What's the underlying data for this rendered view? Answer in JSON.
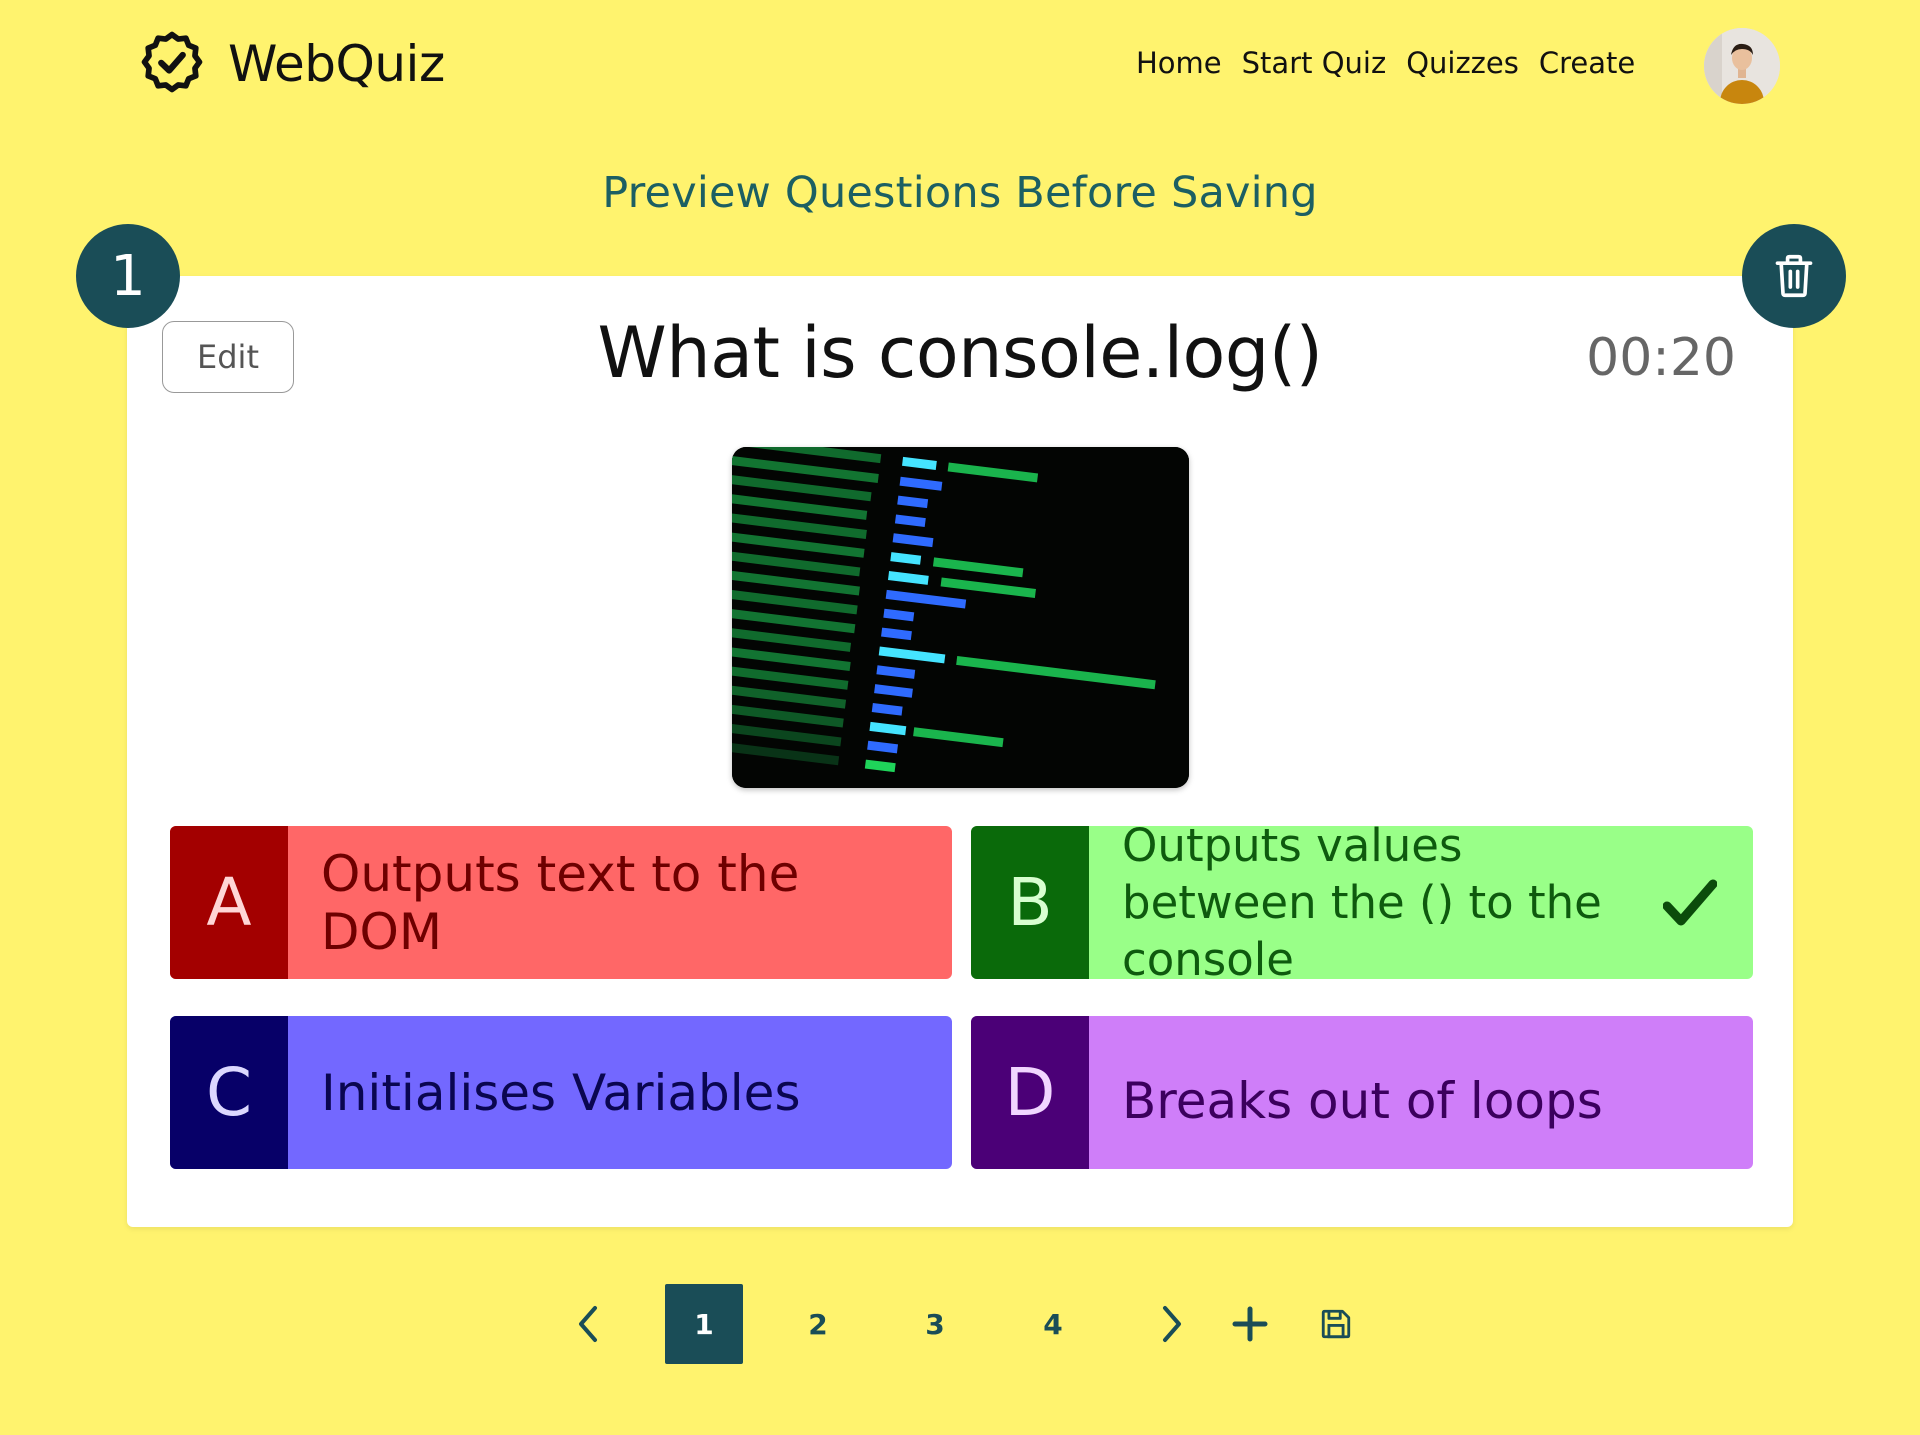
{
  "header": {
    "app_name": "WebQuiz",
    "nav": [
      "Home",
      "Start Quiz",
      "Quizzes",
      "Create"
    ]
  },
  "page": {
    "title": "Preview Questions Before Saving"
  },
  "question": {
    "number": "1",
    "edit_label": "Edit",
    "title": "What is console.log()",
    "timer": "00:20",
    "answers": [
      {
        "letter": "A",
        "text": "Outputs text to the DOM",
        "correct": false
      },
      {
        "letter": "B",
        "text": "Outputs values between the () to the console",
        "correct": true
      },
      {
        "letter": "C",
        "text": "Initialises Variables",
        "correct": false
      },
      {
        "letter": "D",
        "text": "Breaks out of loops",
        "correct": false
      }
    ]
  },
  "pagination": {
    "pages": [
      "1",
      "2",
      "3",
      "4"
    ],
    "active_page": "1"
  },
  "icons": {
    "logo": "badge-check-icon",
    "delete": "trash-icon",
    "prev": "chevron-left-icon",
    "next": "chevron-right-icon",
    "add": "plus-icon",
    "save": "floppy-disk-icon",
    "correct": "checkmark-icon"
  },
  "colors": {
    "background": "#FFF36E",
    "primary": "#1A4D57",
    "title": "#1C5F63",
    "answer_a": "#FF6767",
    "answer_b": "#99FF88",
    "answer_c": "#7368FF",
    "answer_d": "#CF7EF9"
  }
}
